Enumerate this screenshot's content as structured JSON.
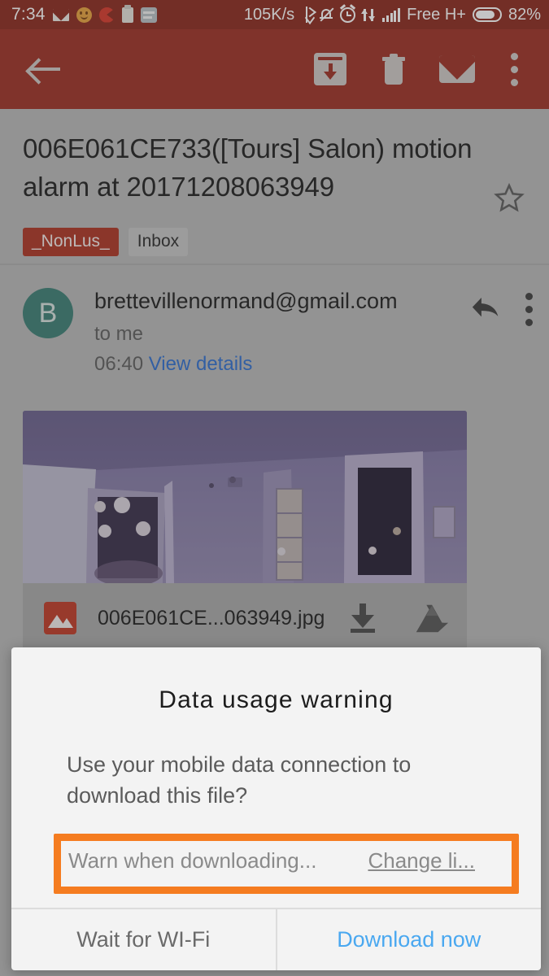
{
  "statusbar": {
    "time": "7:34",
    "network_speed": "105K/s",
    "carrier": "Free H+",
    "battery_percent": "82%",
    "icons_left": [
      "gmail-icon",
      "emoji-icon",
      "pacman-icon",
      "clipboard-icon",
      "card-icon"
    ],
    "icons_right": [
      "bluetooth-icon",
      "bell-muted-icon",
      "alarm-icon",
      "data-transfer-icon",
      "signal-icon",
      "battery-icon"
    ],
    "background_color": "#8c291d"
  },
  "appbar": {
    "back_icon": "back-arrow-icon",
    "archive_icon": "archive-icon",
    "delete_icon": "trash-icon",
    "mark_unread_icon": "mail-icon",
    "overflow_icon": "more-vert-icon",
    "background_color": "#9e3024"
  },
  "email": {
    "subject": "006E061CE733([Tours] Salon) motion alarm at 20171208063949",
    "labels": [
      {
        "text": "_NonLus_",
        "style": "red"
      },
      {
        "text": "Inbox",
        "style": "grey"
      }
    ],
    "starred": false,
    "sender": {
      "avatar_letter": "B",
      "avatar_color": "#3c7f75",
      "email": "brettevillenormand@gmail.com",
      "recipient": "to me",
      "time": "06:40",
      "details_link": "View details"
    },
    "attachment": {
      "filename": "006E061CE...063949.jpg",
      "download_icon": "download-icon",
      "drive_icon": "google-drive-icon",
      "file_type_icon": "image-file-icon"
    }
  },
  "dialog": {
    "title": "Data  usage  warning",
    "body": "Use your mobile data connection to download this file?",
    "preference_label": "Warn when downloading...",
    "change_link": "Change li...",
    "buttons": {
      "secondary": "Wait for WI-Fi",
      "primary": "Download now"
    },
    "primary_color": "#4aa8f0",
    "highlight_color": "#f57c20"
  }
}
